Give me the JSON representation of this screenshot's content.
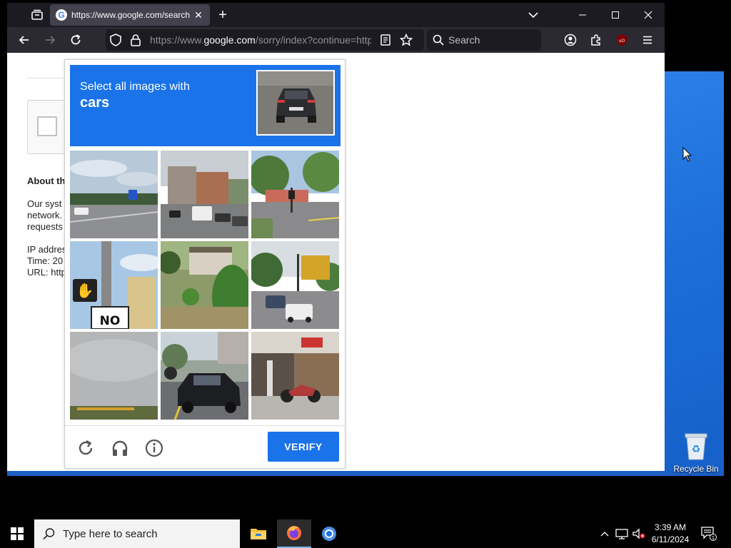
{
  "browser": {
    "tab": {
      "title": "https://www.google.com/search",
      "favicon": "G"
    },
    "url": {
      "prefix": "https://www.",
      "domain": "google.com",
      "rest": "/sorry/index?continue=http"
    },
    "search_placeholder": "Search"
  },
  "page": {
    "about_heading": "About th",
    "para1": [
      "Our syst",
      "network.",
      "requests"
    ],
    "para2": [
      "IP addres",
      "Time: 20",
      "URL: http"
    ]
  },
  "captcha": {
    "instruction": "Select all images with",
    "target": "cars",
    "verify_label": "VERIFY",
    "sign_text": "NO"
  },
  "desktop": {
    "recycle_label": "Recycle Bin"
  },
  "taskbar": {
    "search_placeholder": "Type here to search",
    "time": "3:39 AM",
    "date": "6/11/2024",
    "notification_count": "1"
  },
  "colors": {
    "captcha_blue": "#1a73e8",
    "browser_dark": "#1c1b22",
    "toolbar": "#2b2a33"
  }
}
